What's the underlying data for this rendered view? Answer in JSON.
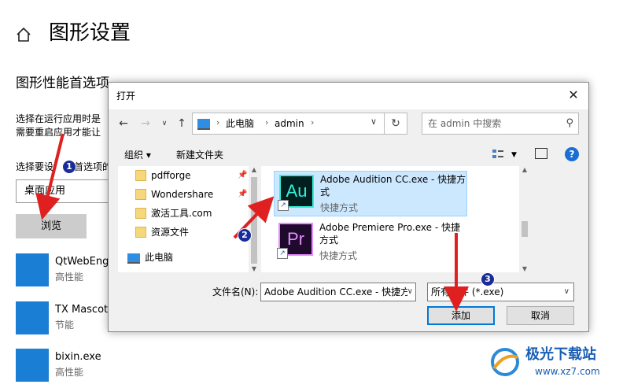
{
  "settings": {
    "page_title": "图形设置",
    "section_title": "图形性能首选项",
    "desc_line1": "选择在运行应用时是",
    "desc_line2": "需要重启应用才能让",
    "choose_label": "选择要设",
    "choose_label_tail": "首选项的",
    "app_type_selected": "桌面应用",
    "browse_label": "浏览",
    "apps": [
      {
        "name": "QtWebEngi",
        "pref": "高性能",
        "icon_color": "#1a7fd4"
      },
      {
        "name": "TX Mascot.",
        "pref": "节能",
        "icon_color": "#1a7fd4"
      },
      {
        "name": "bixin.exe",
        "pref": "高性能",
        "icon_color": "#1a7fd4"
      }
    ]
  },
  "dialog": {
    "title": "打开",
    "address": {
      "segments": [
        "此电脑",
        "admin"
      ]
    },
    "search_placeholder": "在 admin 中搜索",
    "toolbar": {
      "organize": "组织 ▾",
      "new_folder": "新建文件夹"
    },
    "nav_items": [
      {
        "label": "pdfforge",
        "pinned": true
      },
      {
        "label": "Wondershare",
        "pinned": true
      },
      {
        "label": "激活工具.com",
        "pinned": false
      },
      {
        "label": "资源文件",
        "pinned": false
      }
    ],
    "nav_pc": "此电脑",
    "files": [
      {
        "name": "Adobe Audition CC.exe - 快捷方式",
        "type": "快捷方式",
        "logo": "Au",
        "selected": true
      },
      {
        "name": "Adobe Premiere Pro.exe - 快捷方式",
        "type": "快捷方式",
        "logo": "Pr",
        "selected": false
      }
    ],
    "filename_label": "文件名(N):",
    "filename_value": "Adobe Audition CC.exe - 快捷方",
    "filetype_value": "所有文件 (*.exe)",
    "add_label": "添加",
    "cancel_label": "取消"
  },
  "annotations": {
    "steps": [
      "1",
      "2",
      "3"
    ],
    "color": "#e02020"
  },
  "watermark": {
    "name": "极光下载站",
    "url": "www.xz7.com"
  }
}
